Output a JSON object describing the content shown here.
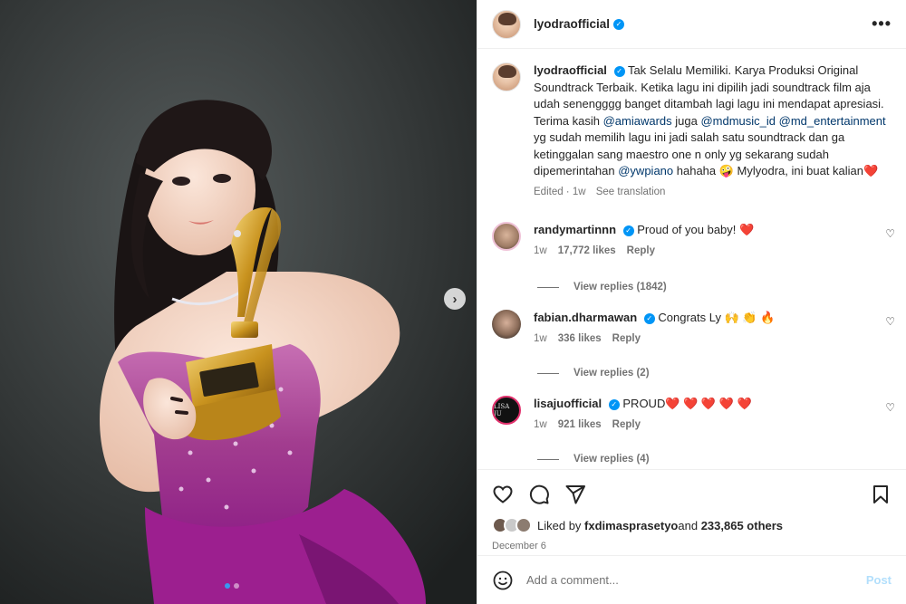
{
  "post": {
    "username": "lyodraofficial",
    "verified": true
  },
  "caption": {
    "username": "lyodraofficial",
    "text_1": "Tak Selalu Memiliki. Karya Produksi Original Soundtrack Terbaik. Ketika lagu ini dipilih jadi soundtrack film aja udah senengggg banget ditambah lagi lagu ini mendapat apresiasi. Terima kasih ",
    "mention_1": "@amiawards",
    "text_2": " juga ",
    "mention_2": "@mdmusic_id",
    "mention_3": "@md_entertainment",
    "text_3": " yg sudah memilih lagu ini jadi salah satu soundtrack dan ga ketinggalan sang maestro one n only yg sekarang sudah dipemerintahan ",
    "mention_4": "@ywpiano",
    "text_4": " hahaha 🤪 Mylyodra, ini buat kalian❤️",
    "edited": "Edited · 1w",
    "see_translation": "See translation"
  },
  "comments": [
    {
      "username": "randymartinnn",
      "text": "Proud of you baby! ❤️",
      "time": "1w",
      "likes": "17,772 likes",
      "reply": "Reply",
      "view_replies": "View replies (1842)"
    },
    {
      "username": "fabian.dharmawan",
      "text": "Congrats Ly 🙌 👏 🔥",
      "time": "1w",
      "likes": "336 likes",
      "reply": "Reply",
      "view_replies": "View replies (2)"
    },
    {
      "username": "lisajuofficial",
      "text": "PROUD❤️ ❤️ ❤️ ❤️ ❤️",
      "time": "1w",
      "likes": "921 likes",
      "reply": "Reply",
      "view_replies": "View replies (4)"
    }
  ],
  "likes": {
    "prefix": "Liked by ",
    "user": "fxdimasprasetyo",
    "middle": " and ",
    "others": "233,865 others"
  },
  "date": "December 6",
  "add_comment": {
    "placeholder": "Add a comment...",
    "post_label": "Post"
  },
  "carousel": {
    "current": 1,
    "total": 2
  },
  "colors": {
    "verified": "#0095f6",
    "mention": "#00376b",
    "post_disabled": "#b2dffc",
    "dress": "#9b2a8a"
  }
}
